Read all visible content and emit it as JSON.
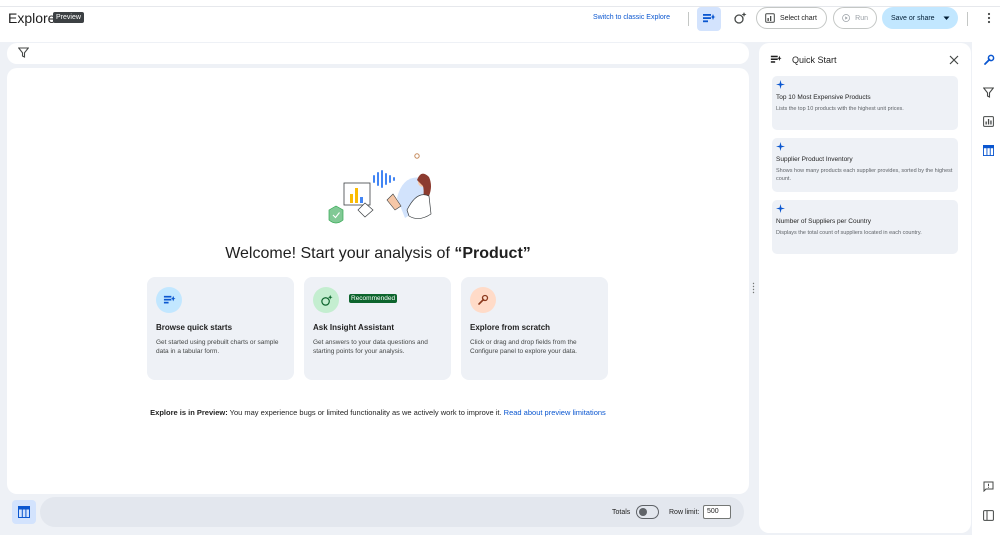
{
  "header": {
    "title": "Explore",
    "preview_badge": "Preview",
    "switch_link": "Switch to classic Explore",
    "select_chart": "Select chart",
    "run": "Run",
    "save_or_share": "Save or share"
  },
  "welcome": {
    "prefix": "Welcome! Start your analysis of ",
    "subject": "“Product”"
  },
  "cards": [
    {
      "title": "Browse quick starts",
      "desc": "Get started using prebuilt charts or sample data in a tabular form."
    },
    {
      "title": "Ask Insight Assistant",
      "badge": "Recommended",
      "desc": "Get answers to your data questions and starting points for your analysis."
    },
    {
      "title": "Explore from scratch",
      "desc": "Click or drag and drop fields from the Configure panel to explore your data."
    }
  ],
  "preview_note": {
    "bold": "Explore is in Preview:",
    "text": " You may experience bugs or limited functionality as we actively work to improve it. ",
    "link": "Read about preview limitations"
  },
  "bottom": {
    "totals_label": "Totals",
    "totals_on": false,
    "row_limit_label": "Row limit:",
    "row_limit_value": "500"
  },
  "quick_start": {
    "title": "Quick Start",
    "items": [
      {
        "title": "Top 10 Most Expensive Products",
        "desc": "Lists the top 10 products with the highest unit prices."
      },
      {
        "title": "Supplier Product Inventory",
        "desc": "Shows how many products each supplier provides, sorted by the highest count."
      },
      {
        "title": "Number of Suppliers per Country",
        "desc": "Displays the total count of suppliers located in each country."
      }
    ]
  },
  "colors": {
    "accent": "#0b57d0",
    "accent_light": "#d3e3fd",
    "save_bg": "#c2e7ff",
    "panel_bg": "#eef1f6",
    "recommended": "#0d652d"
  },
  "icons": {
    "rail": [
      "wrench-icon",
      "filter-icon",
      "chart-icon",
      "table-icon",
      "feedback-icon",
      "panel-toggle-icon"
    ]
  }
}
